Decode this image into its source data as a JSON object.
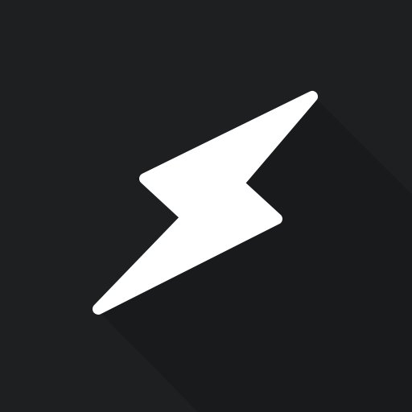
{
  "icon": {
    "name": "lightning-bolt-icon",
    "background_color": "#1d1f20",
    "glyph_color": "#ffffff",
    "shadow_color": "#151617"
  }
}
